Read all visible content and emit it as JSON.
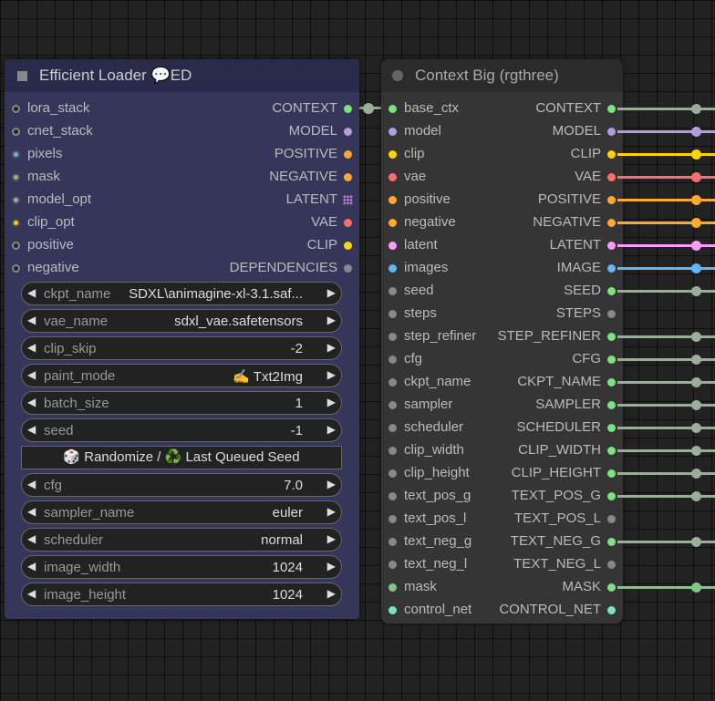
{
  "efficient_loader": {
    "title": "Efficient Loader 💬ED",
    "inputs": [
      {
        "label": "lora_stack",
        "color": "#888888"
      },
      {
        "label": "cnet_stack",
        "color": "#888888"
      },
      {
        "label": "pixels",
        "color": "#64b5f6"
      },
      {
        "label": "mask",
        "color": "#81c784"
      },
      {
        "label": "model_opt",
        "color": "#b39ddb"
      },
      {
        "label": "clip_opt",
        "color": "#ffd500"
      },
      {
        "label": "positive",
        "color": "#888888"
      },
      {
        "label": "negative",
        "color": "#888888"
      }
    ],
    "outputs": [
      {
        "label": "CONTEXT",
        "color": "#7ee07e"
      },
      {
        "label": "MODEL",
        "color": "#b39ddb"
      },
      {
        "label": "POSITIVE",
        "color": "#ffa931"
      },
      {
        "label": "NEGATIVE",
        "color": "#ffa931"
      },
      {
        "label": "LATENT",
        "color": "#c07ad8"
      },
      {
        "label": "VAE",
        "color": "#ff6e6e"
      },
      {
        "label": "CLIP",
        "color": "#ffd500"
      },
      {
        "label": "DEPENDENCIES",
        "color": "#888888"
      }
    ],
    "widgets": [
      {
        "name": "ckpt_name",
        "value": "SDXL\\animagine-xl-3.1.saf..."
      },
      {
        "name": "vae_name",
        "value": "sdxl_vae.safetensors"
      },
      {
        "name": "clip_skip",
        "value": "-2"
      },
      {
        "name": "paint_mode",
        "value": "✍️ Txt2Img"
      },
      {
        "name": "batch_size",
        "value": "1"
      },
      {
        "name": "seed",
        "value": "-1"
      }
    ],
    "button_label": "🎲 Randomize / ♻️ Last Queued Seed",
    "widgets2": [
      {
        "name": "cfg",
        "value": "7.0"
      },
      {
        "name": "sampler_name",
        "value": "euler"
      },
      {
        "name": "scheduler",
        "value": "normal"
      },
      {
        "name": "image_width",
        "value": "1024"
      },
      {
        "name": "image_height",
        "value": "1024"
      }
    ],
    "arrow_left": "◀",
    "arrow_right": "▶"
  },
  "context_big": {
    "title": "Context Big (rgthree)",
    "rows": [
      {
        "in": "base_ctx",
        "out": "CONTEXT",
        "in_color": "#7ee07e",
        "out_color": "#7ee07e",
        "wire": "#9aae9a"
      },
      {
        "in": "model",
        "out": "MODEL",
        "in_color": "#b39ddb",
        "out_color": "#b39ddb",
        "wire": "#b39ddb"
      },
      {
        "in": "clip",
        "out": "CLIP",
        "in_color": "#ffd500",
        "out_color": "#ffd500",
        "wire": "#ffd500"
      },
      {
        "in": "vae",
        "out": "VAE",
        "in_color": "#ff6e6e",
        "out_color": "#ff6e6e",
        "wire": "#ff6e6e"
      },
      {
        "in": "positive",
        "out": "POSITIVE",
        "in_color": "#ffa931",
        "out_color": "#ffa931",
        "wire": "#ffa931"
      },
      {
        "in": "negative",
        "out": "NEGATIVE",
        "in_color": "#ffa931",
        "out_color": "#ffa931",
        "wire": "#ffa931"
      },
      {
        "in": "latent",
        "out": "LATENT",
        "in_color": "#ff9cf9",
        "out_color": "#ff9cf9",
        "wire": "#ff9cf9"
      },
      {
        "in": "images",
        "out": "IMAGE",
        "in_color": "#64b5f6",
        "out_color": "#64b5f6",
        "wire": "#64b5f6"
      },
      {
        "in": "seed",
        "out": "SEED",
        "in_color": "#888888",
        "out_color": "#7ee07e",
        "wire": "#9aae9a"
      },
      {
        "in": "steps",
        "out": "STEPS",
        "in_color": "#888888",
        "out_color": "#888888",
        "wire": ""
      },
      {
        "in": "step_refiner",
        "out": "STEP_REFINER",
        "in_color": "#888888",
        "out_color": "#7ee07e",
        "wire": "#9aae9a"
      },
      {
        "in": "cfg",
        "out": "CFG",
        "in_color": "#888888",
        "out_color": "#7ee07e",
        "wire": "#9aae9a"
      },
      {
        "in": "ckpt_name",
        "out": "CKPT_NAME",
        "in_color": "#888888",
        "out_color": "#7ee07e",
        "wire": "#9aae9a"
      },
      {
        "in": "sampler",
        "out": "SAMPLER",
        "in_color": "#888888",
        "out_color": "#7ee07e",
        "wire": "#9aae9a"
      },
      {
        "in": "scheduler",
        "out": "SCHEDULER",
        "in_color": "#888888",
        "out_color": "#7ee07e",
        "wire": "#9aae9a"
      },
      {
        "in": "clip_width",
        "out": "CLIP_WIDTH",
        "in_color": "#888888",
        "out_color": "#7ee07e",
        "wire": "#9aae9a"
      },
      {
        "in": "clip_height",
        "out": "CLIP_HEIGHT",
        "in_color": "#888888",
        "out_color": "#7ee07e",
        "wire": "#9aae9a"
      },
      {
        "in": "text_pos_g",
        "out": "TEXT_POS_G",
        "in_color": "#888888",
        "out_color": "#7ee07e",
        "wire": "#9aae9a"
      },
      {
        "in": "text_pos_l",
        "out": "TEXT_POS_L",
        "in_color": "#888888",
        "out_color": "#888888",
        "wire": ""
      },
      {
        "in": "text_neg_g",
        "out": "TEXT_NEG_G",
        "in_color": "#888888",
        "out_color": "#7ee07e",
        "wire": "#9aae9a"
      },
      {
        "in": "text_neg_l",
        "out": "TEXT_NEG_L",
        "in_color": "#888888",
        "out_color": "#888888",
        "wire": ""
      },
      {
        "in": "mask",
        "out": "MASK",
        "in_color": "#81c784",
        "out_color": "#7ee07e",
        "wire": "#81c784"
      },
      {
        "in": "control_net",
        "out": "CONTROL_NET",
        "in_color": "#7ae0c0",
        "out_color": "#7ae0c0",
        "wire": ""
      }
    ]
  }
}
